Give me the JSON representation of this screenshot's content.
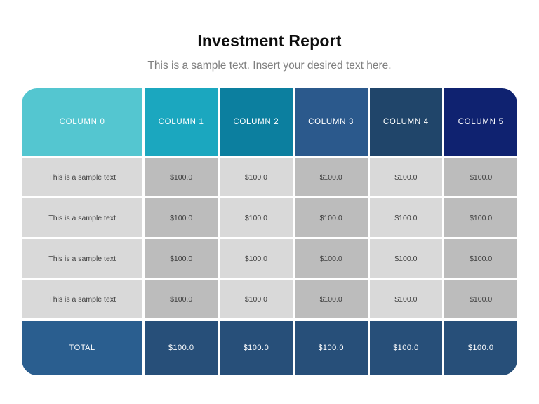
{
  "header": {
    "title": "Investment Report",
    "subtitle": "This is a sample text. Insert your desired text here."
  },
  "table": {
    "columns": [
      {
        "label": "COLUMN 0",
        "header_color": "#54c6d0"
      },
      {
        "label": "COLUMN 1",
        "header_color": "#1ba7bf"
      },
      {
        "label": "COLUMN 2",
        "header_color": "#0c7f9f"
      },
      {
        "label": "COLUMN 3",
        "header_color": "#2b598c"
      },
      {
        "label": "COLUMN 4",
        "header_color": "#20456a"
      },
      {
        "label": "COLUMN 5",
        "header_color": "#0f2270"
      }
    ],
    "cell_shades": {
      "light": "#d9d9d9",
      "dark": "#bcbcbc"
    },
    "rows": [
      [
        "This is a sample text",
        "$100.0",
        "$100.0",
        "$100.0",
        "$100.0",
        "$100.0"
      ],
      [
        "This is a sample text",
        "$100.0",
        "$100.0",
        "$100.0",
        "$100.0",
        "$100.0"
      ],
      [
        "This is a sample text",
        "$100.0",
        "$100.0",
        "$100.0",
        "$100.0",
        "$100.0"
      ],
      [
        "This is a sample text",
        "$100.0",
        "$100.0",
        "$100.0",
        "$100.0",
        "$100.0"
      ]
    ],
    "total_row": {
      "cells": [
        "TOTAL",
        "$100.0",
        "$100.0",
        "$100.0",
        "$100.0",
        "$100.0"
      ],
      "first_color": "#2a5e8f",
      "color": "#274f79"
    }
  }
}
